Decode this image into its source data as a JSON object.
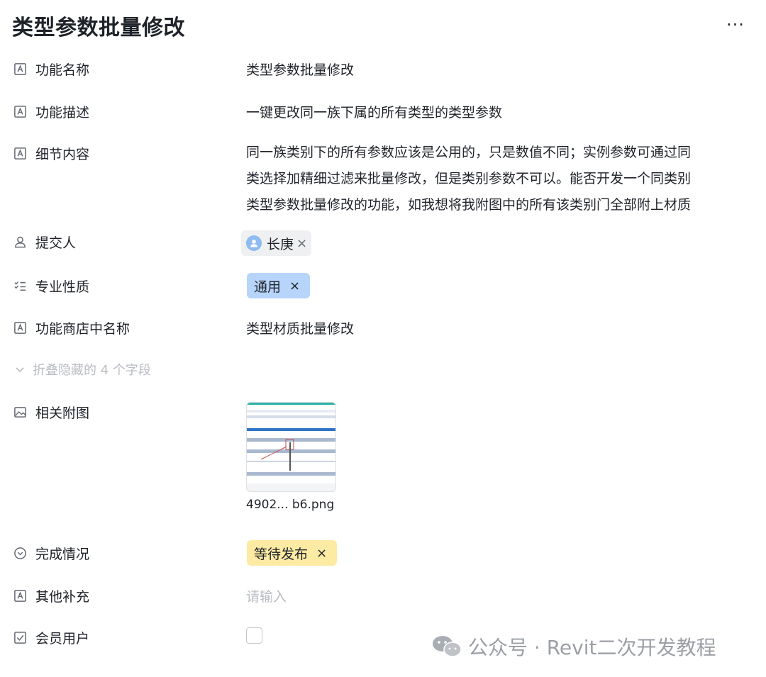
{
  "header": {
    "title": "类型参数批量修改",
    "more_label": "···"
  },
  "fields": [
    {
      "label": "功能名称",
      "icon": "text-field-icon",
      "value": "类型参数批量修改"
    },
    {
      "label": "功能描述",
      "icon": "text-field-icon",
      "value": "一键更改同一族下属的所有类型的类型参数"
    },
    {
      "label": "细节内容",
      "icon": "text-field-icon",
      "lines": [
        "同一族类别下的所有参数应该是公用的，只是数值不同；实例参数可通过同",
        "类选择加精细过滤来批量修改，但是类别参数不可以。能否开发一个同类别",
        "类型参数批量修改的功能，如我想将我附图中的所有该类别门全部附上材质"
      ]
    },
    {
      "label": "提交人",
      "icon": "person-icon",
      "value": "长庚"
    },
    {
      "label": "专业性质",
      "icon": "checklist-icon",
      "value": "通用"
    },
    {
      "label": "功能商店中名称",
      "icon": "text-field-icon",
      "value": "类型材质批量修改"
    },
    {
      "label": "相关附图",
      "icon": "image-icon",
      "value": "4902...  b6.png"
    },
    {
      "label": "完成情况",
      "icon": "status-circle-icon",
      "value": "等待发布"
    },
    {
      "label": "其他补充",
      "icon": "text-field-icon",
      "placeholder": "请输入"
    },
    {
      "label": "会员用户",
      "icon": "checkbox-icon",
      "checked": false
    }
  ],
  "collapse": {
    "label": "折叠隐藏的 4 个字段"
  },
  "watermark": {
    "text": "公众号 · Revit二次开发教程"
  },
  "colors": {
    "tag_blue": "#b7d4fb",
    "tag_yellow": "#fdeaa3",
    "avatar": "#8ebbf0"
  }
}
